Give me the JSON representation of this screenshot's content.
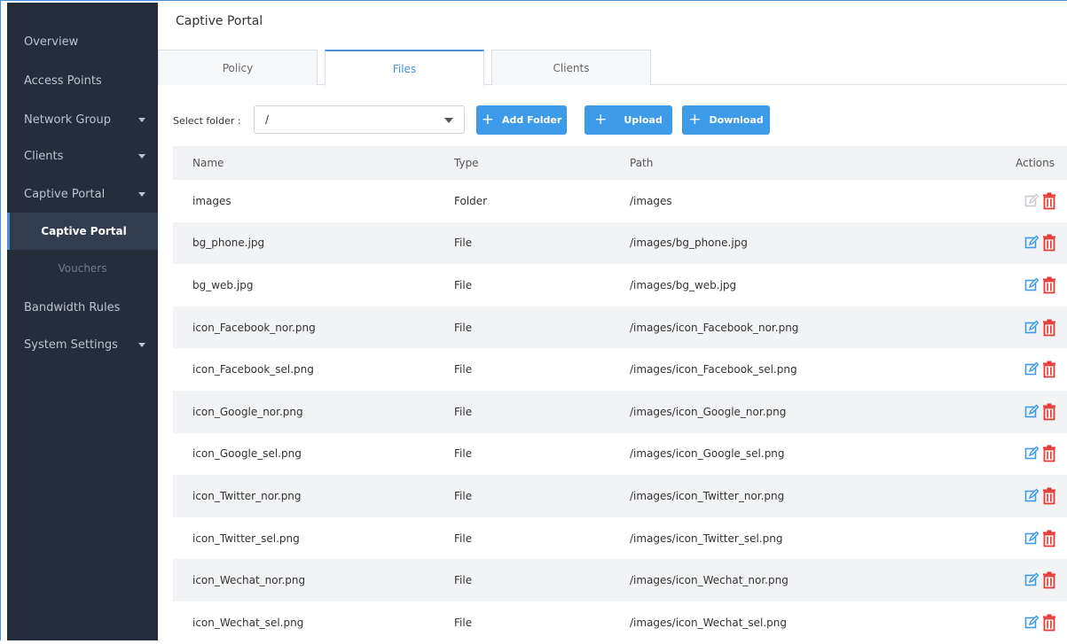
{
  "sidebar": {
    "items": [
      {
        "label": "Overview"
      },
      {
        "label": "Access Points"
      },
      {
        "label": "Network Group"
      },
      {
        "label": "Clients"
      },
      {
        "label": "Captive Portal"
      },
      {
        "label": "Bandwidth Rules"
      },
      {
        "label": "System Settings"
      }
    ],
    "sub": [
      {
        "label": "Captive Portal"
      },
      {
        "label": "Vouchers"
      }
    ]
  },
  "page": {
    "title": "Captive Portal"
  },
  "tabs": [
    {
      "label": "Policy"
    },
    {
      "label": "Files"
    },
    {
      "label": "Clients"
    }
  ],
  "toolbar": {
    "select_label": "Select folder :",
    "folder_value": "/",
    "add_folder": "Add Folder",
    "upload": "Upload",
    "download": "Download"
  },
  "table": {
    "headers": {
      "name": "Name",
      "type": "Type",
      "path": "Path",
      "actions": "Actions"
    },
    "rows": [
      {
        "name": "images",
        "type": "Folder",
        "path": "/images"
      },
      {
        "name": "bg_phone.jpg",
        "type": "File",
        "path": "/images/bg_phone.jpg"
      },
      {
        "name": "bg_web.jpg",
        "type": "File",
        "path": "/images/bg_web.jpg"
      },
      {
        "name": "icon_Facebook_nor.png",
        "type": "File",
        "path": "/images/icon_Facebook_nor.png"
      },
      {
        "name": "icon_Facebook_sel.png",
        "type": "File",
        "path": "/images/icon_Facebook_sel.png"
      },
      {
        "name": "icon_Google_nor.png",
        "type": "File",
        "path": "/images/icon_Google_nor.png"
      },
      {
        "name": "icon_Google_sel.png",
        "type": "File",
        "path": "/images/icon_Google_sel.png"
      },
      {
        "name": "icon_Twitter_nor.png",
        "type": "File",
        "path": "/images/icon_Twitter_nor.png"
      },
      {
        "name": "icon_Twitter_sel.png",
        "type": "File",
        "path": "/images/icon_Twitter_sel.png"
      },
      {
        "name": "icon_Wechat_nor.png",
        "type": "File",
        "path": "/images/icon_Wechat_nor.png"
      },
      {
        "name": "icon_Wechat_sel.png",
        "type": "File",
        "path": "/images/icon_Wechat_sel.png"
      }
    ]
  },
  "icons": {
    "edit": "edit-icon",
    "delete": "trash-icon",
    "dropdown": "caret-down-icon",
    "add": "plus-icon"
  },
  "colors": {
    "accent": "#3d9be9",
    "sidebar_bg": "#252d3b",
    "delete_red": "#e53935",
    "edit_blue": "#3d9be9",
    "edit_disabled": "#c8ccd2"
  }
}
